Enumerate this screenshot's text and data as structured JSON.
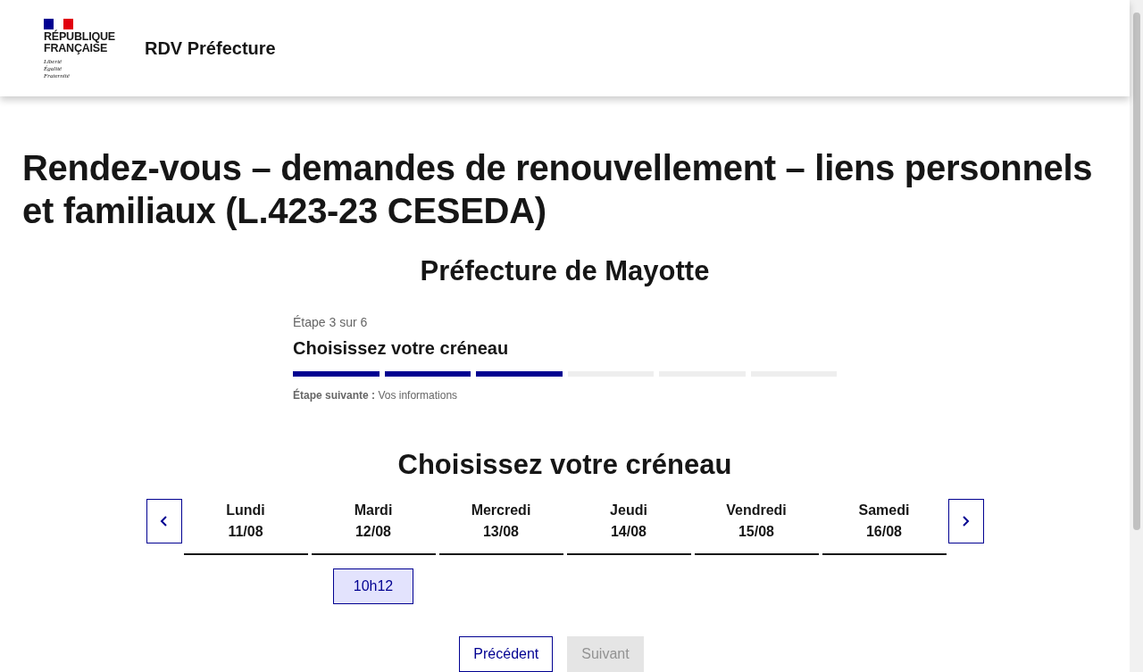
{
  "header": {
    "logo_lines": [
      "RÉPUBLIQUE",
      "FRANÇAISE"
    ],
    "motto_lines": [
      "Liberté",
      "Égalité",
      "Fraternité"
    ],
    "service_title": "RDV Préfecture"
  },
  "page_title": "Rendez-vous – demandes de renouvellement – liens personnels et familiaux (L.423-23 CESEDA)",
  "office": "Préfecture de Mayotte",
  "stepper": {
    "label": "Étape 3 sur 6",
    "title": "Choisissez votre créneau",
    "segments": [
      {
        "filled": true
      },
      {
        "filled": true
      },
      {
        "filled": true
      },
      {
        "filled": false
      },
      {
        "filled": false
      },
      {
        "filled": false
      }
    ],
    "next_label": "Étape suivante :",
    "next_value": "Vos informations"
  },
  "calendar": {
    "title": "Choisissez votre créneau",
    "days": [
      {
        "day": "Lundi",
        "date": "11/08"
      },
      {
        "day": "Mardi",
        "date": "12/08",
        "slots": [
          "10h12"
        ]
      },
      {
        "day": "Mercredi",
        "date": "13/08"
      },
      {
        "day": "Jeudi",
        "date": "14/08"
      },
      {
        "day": "Vendredi",
        "date": "15/08"
      },
      {
        "day": "Samedi",
        "date": "16/08"
      }
    ]
  },
  "buttons": [
    {
      "label": "Précédent",
      "disabled": false
    },
    {
      "label": "Suivant",
      "disabled": true
    }
  ]
}
